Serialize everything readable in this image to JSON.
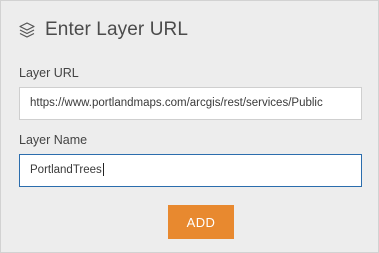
{
  "dialog": {
    "title": "Enter Layer URL",
    "icon": "layers-icon"
  },
  "fields": {
    "url_label": "Layer URL",
    "url_value": "https://www.portlandmaps.com/arcgis/rest/services/Public",
    "name_label": "Layer Name",
    "name_value": "PortlandTrees"
  },
  "actions": {
    "add_label": "ADD"
  },
  "colors": {
    "accent": "#e8892f",
    "focus_border": "#2b6dad",
    "background": "#ededed"
  }
}
